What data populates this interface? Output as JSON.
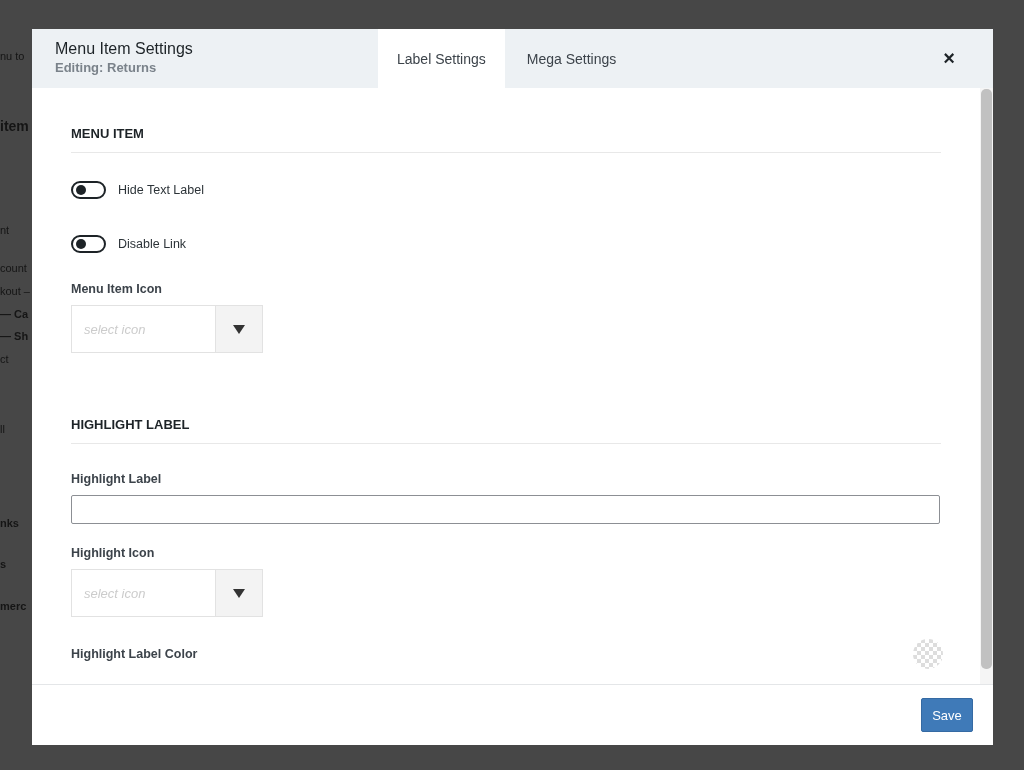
{
  "background": {
    "fragments": [
      {
        "text": "nu to",
        "bold": false,
        "large": false
      },
      {
        "text": "item",
        "bold": true,
        "large": true
      },
      {
        "text": "nt",
        "bold": false,
        "large": false
      },
      {
        "text": "count",
        "bold": false,
        "large": false
      },
      {
        "text": "kout –",
        "bold": false,
        "large": false
      },
      {
        "text": "— Ca",
        "bold": true,
        "large": false
      },
      {
        "text": "— Sh",
        "bold": true,
        "large": false
      },
      {
        "text": "ct",
        "bold": false,
        "large": false
      },
      {
        "text": "ll",
        "bold": false,
        "large": false
      },
      {
        "text": "nks",
        "bold": true,
        "large": false
      },
      {
        "text": "s",
        "bold": true,
        "large": false
      },
      {
        "text": "merc",
        "bold": true,
        "large": false
      }
    ]
  },
  "window": {
    "title": "Menu Item Settings",
    "subtitle": "Editing: Returns",
    "close": "×"
  },
  "tabs": [
    {
      "label": "Label Settings",
      "selected": true
    },
    {
      "label": "Mega Settings",
      "selected": false
    }
  ],
  "sections": [
    {
      "heading": "MENU ITEM",
      "fields": [
        {
          "kind": "toggle",
          "label": "Hide Text Label",
          "on": false
        },
        {
          "kind": "toggle",
          "label": "Disable Link",
          "on": false
        },
        {
          "kind": "icon_select",
          "label": "Menu Item Icon",
          "placeholder": "select icon"
        }
      ]
    },
    {
      "heading": "HIGHLIGHT LABEL",
      "fields": [
        {
          "kind": "text",
          "label": "Highlight Label"
        },
        {
          "kind": "icon_select",
          "label": "Highlight Icon",
          "placeholder": "select icon"
        },
        {
          "kind": "color",
          "label": "Highlight Label Color"
        }
      ]
    }
  ],
  "footer": {
    "save": "Save"
  }
}
